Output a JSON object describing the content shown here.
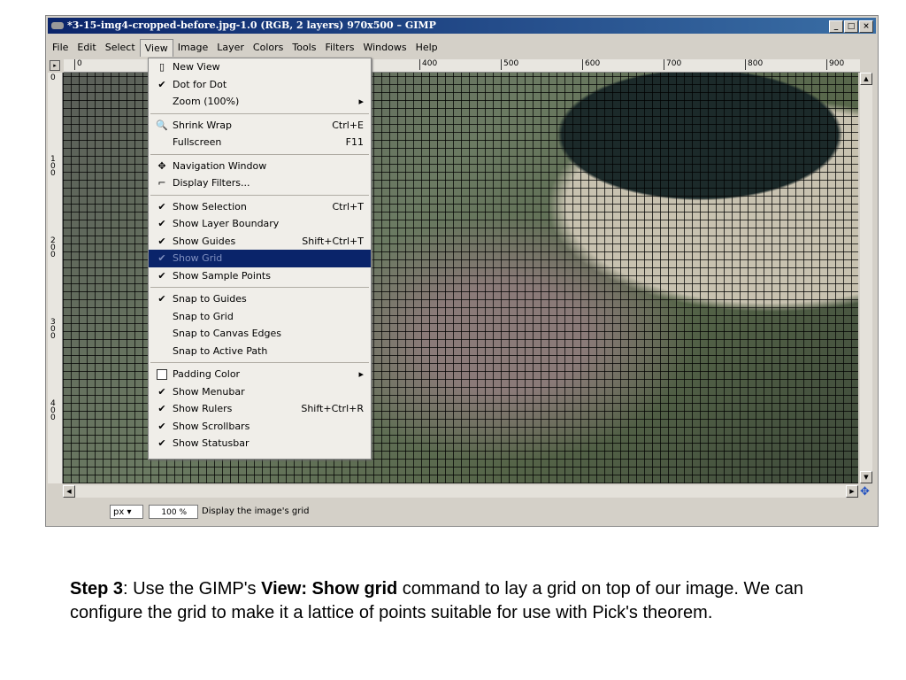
{
  "window": {
    "title": "*3-15-img4-cropped-before.jpg-1.0 (RGB, 2 layers) 970x500 – GIMP",
    "controls": [
      "_",
      "□",
      "×"
    ]
  },
  "menubar": [
    "File",
    "Edit",
    "Select",
    "View",
    "Image",
    "Layer",
    "Colors",
    "Tools",
    "Filters",
    "Windows",
    "Help"
  ],
  "ruler_h": [
    "0",
    "400",
    "500",
    "600",
    "700",
    "800",
    "900"
  ],
  "ruler_v": [
    "0",
    "100",
    "200",
    "300",
    "400"
  ],
  "view_menu": [
    {
      "label": "New View",
      "check": "page-icon",
      "accel": ""
    },
    {
      "label": "Dot for Dot",
      "check": "✔",
      "accel": ""
    },
    {
      "label": "Zoom (100%)",
      "check": "",
      "accel": "▸"
    },
    {
      "sep": true
    },
    {
      "label": "Shrink Wrap",
      "check": "🔍",
      "accel": "Ctrl+E"
    },
    {
      "label": "Fullscreen",
      "check": "",
      "accel": "F11"
    },
    {
      "sep": true
    },
    {
      "label": "Navigation Window",
      "check": "✥",
      "accel": ""
    },
    {
      "label": "Display Filters...",
      "check": "⌐",
      "accel": ""
    },
    {
      "sep": true
    },
    {
      "label": "Show Selection",
      "check": "✔",
      "accel": "Ctrl+T"
    },
    {
      "label": "Show Layer Boundary",
      "check": "✔",
      "accel": ""
    },
    {
      "label": "Show Guides",
      "check": "✔",
      "accel": "Shift+Ctrl+T"
    },
    {
      "label": "Show Grid",
      "check": "✔",
      "accel": "",
      "highlighted": true
    },
    {
      "label": "Show Sample Points",
      "check": "✔",
      "accel": ""
    },
    {
      "sep": true
    },
    {
      "label": "Snap to Guides",
      "check": "✔",
      "accel": ""
    },
    {
      "label": "Snap to Grid",
      "check": "",
      "accel": ""
    },
    {
      "label": "Snap to Canvas Edges",
      "check": "",
      "accel": ""
    },
    {
      "label": "Snap to Active Path",
      "check": "",
      "accel": ""
    },
    {
      "sep": true
    },
    {
      "label": "Padding Color",
      "check": "box",
      "accel": "▸"
    },
    {
      "label": "Show Menubar",
      "check": "✔",
      "accel": ""
    },
    {
      "label": "Show Rulers",
      "check": "✔",
      "accel": "Shift+Ctrl+R"
    },
    {
      "label": "Show Scrollbars",
      "check": "✔",
      "accel": ""
    },
    {
      "label": "Show Statusbar",
      "check": "✔",
      "accel": ""
    }
  ],
  "status": {
    "unit": "px",
    "zoom": "100 %",
    "hint": "Display the image's grid"
  },
  "caption": {
    "step": "Step 3",
    "t1": ": Use the GIMP's ",
    "cmd": "View: Show grid",
    "t2": " command to lay a grid on top of our image. We can configure the grid to make it a lattice of points suitable for use with Pick's theorem."
  }
}
